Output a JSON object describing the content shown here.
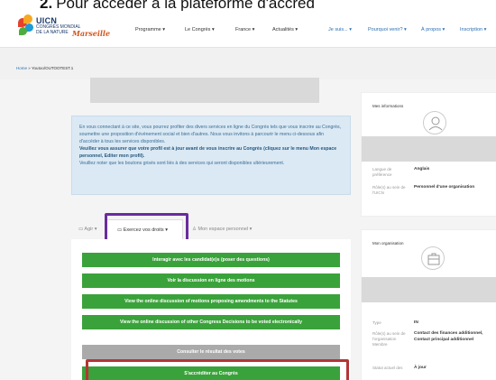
{
  "caption": {
    "number": "2.",
    "text": "Pour accéder à la plateforme d'accréd"
  },
  "header": {
    "logo": {
      "line1": "UICN",
      "line2": "CONGRÈS MONDIAL DE LA NATURE",
      "line3": "Marseille"
    },
    "nav": [
      {
        "label": "Programme ▾"
      },
      {
        "label": "Le Congrès ▾"
      },
      {
        "label": "France ▾"
      },
      {
        "label": "Actualités ▾"
      },
      {
        "label": "Je suis... ▾"
      },
      {
        "label": "Pourquoi venir? ▾"
      },
      {
        "label": "À propos ▾"
      },
      {
        "label": "Inscription ▾"
      }
    ]
  },
  "breadcrumb": {
    "home": "Home",
    "separator": "»",
    "current": "Youtoo/OUTOOTEST.1"
  },
  "info": {
    "p1": "En vous connectant à ce site, vous pourrez profiter des divers services en ligne du Congrès tels que vous inscrire au Congrès, soumettre une proposition d'événement social et bien d'autres. Nous vous invitons à parcourir le menu ci-dessous afin d'accéder à tous les services disponibles.",
    "p2_bold": "Veuillez vous assurer que votre profil est à jour avant de vous inscrire au Congrès (cliquez sur le menu Mon espace personnel, Editer mon profil).",
    "p3": "Veuillez noter que les boutons grisés sont liés à des services qui seront disponibles ultérieurement."
  },
  "tabs": {
    "agir": "Agir ▾",
    "exercez": "Exercez vos droits ▾",
    "espace": "Mon espace personnel ▾"
  },
  "actions": [
    {
      "label": "Interagir avec les candidat(e)s (poser des questions)",
      "state": "active"
    },
    {
      "label": "Voir la discussion en ligne des motions",
      "state": "active"
    },
    {
      "label": "View the online discussion of motions proposing amendments to the Statutes",
      "state": "active"
    },
    {
      "label": "View the online discussion of other Congress Decisions to be voted electronically",
      "state": "active"
    },
    {
      "label": "Consulter le résultat des votes",
      "state": "disabled"
    },
    {
      "label": "S'accréditer au Congrès",
      "state": "active"
    }
  ],
  "sidebar": {
    "infos": {
      "title": "Mes informations",
      "langue_label": "Langue de préférence",
      "langue_value": "Anglais",
      "role_label": "Rôle(s) au sein de l'UICN",
      "role_value": "Personnel d'une organisation"
    },
    "org": {
      "title": "Mon organisation",
      "type_label": "Type",
      "type_value": "IN",
      "role_label": "Rôle(s) au sein de l'organisation Membre",
      "role_value": "Contact des finances additionnel, Contact principal additionnel",
      "statut_label": "Statut actuel des",
      "statut_value": "À jour"
    }
  },
  "colors": {
    "green": "#3aa23a",
    "grey": "#aaaaaa",
    "purple_highlight": "#6a2c9c",
    "red_highlight": "#b53434",
    "info_bg": "#dbe9f4"
  }
}
